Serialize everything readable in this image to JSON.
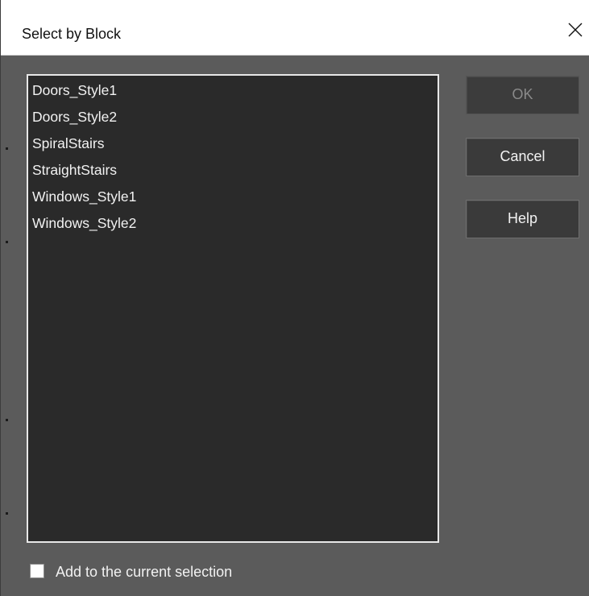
{
  "window": {
    "title": "Select by Block"
  },
  "blocks": {
    "items": [
      "Doors_Style1",
      "Doors_Style2",
      "SpiralStairs",
      "StraightStairs",
      "Windows_Style1",
      "Windows_Style2"
    ]
  },
  "buttons": {
    "ok_label": "OK",
    "ok_enabled": false,
    "cancel_label": "Cancel",
    "help_label": "Help"
  },
  "options": {
    "add_to_selection_label": "Add to the current selection",
    "add_to_selection_checked": false
  },
  "colors": {
    "dialog_bg": "#5b5b5b",
    "list_bg": "#2a2a2a",
    "button_bg": "#3a3a3a",
    "text": "#f2f2f2"
  },
  "icons": {
    "close": "close-icon"
  }
}
